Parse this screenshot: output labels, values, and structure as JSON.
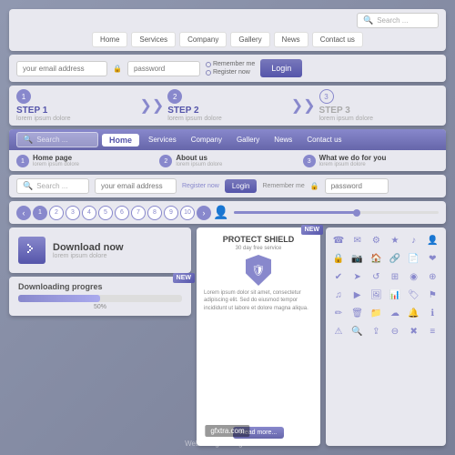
{
  "title": "Web design navigation set",
  "nav1": {
    "search_placeholder": "Search ...",
    "links": [
      "Home",
      "Services",
      "Company",
      "Gallery",
      "News",
      "Contact us"
    ]
  },
  "login1": {
    "email_placeholder": "your email address",
    "password_placeholder": "password",
    "remember_me": "Remember me",
    "register_now": "Register now",
    "login_btn": "Login"
  },
  "steps": {
    "step1_title": "STEP 1",
    "step1_sub": "lorem ipsum dolore",
    "step2_title": "STEP 2",
    "step2_sub": "lorem ipsum dolore",
    "step3_title": "STEP 3",
    "step3_sub": "lorem ipsum dolore"
  },
  "nav2": {
    "search_placeholder": "Search ...",
    "home": "Home",
    "links": [
      "Services",
      "Company",
      "Gallery",
      "News",
      "Contact us"
    ],
    "pages": [
      {
        "num": "1",
        "title": "Home page",
        "sub": "lorem ipsum dolore"
      },
      {
        "num": "2",
        "title": "About us",
        "sub": "lorem ipsum dolore"
      },
      {
        "num": "3",
        "title": "What we do for you",
        "sub": "lorem ipsum dolore"
      }
    ]
  },
  "login2": {
    "email_placeholder": "your email address",
    "register_label": "Register now",
    "login_btn": "Login",
    "remember_label": "Remember me",
    "password_placeholder": "password"
  },
  "pagination": {
    "pages": [
      "1",
      "2",
      "3",
      "4",
      "5",
      "6",
      "7",
      "8",
      "9",
      "10"
    ],
    "active": "1"
  },
  "download": {
    "title": "Download now",
    "subtitle": "lorem ipsum dolore"
  },
  "progress": {
    "title": "Downloading progres",
    "percent": "50%",
    "new_badge": "NEW"
  },
  "protect": {
    "new_badge": "NEW",
    "title": "PROTECT SHIELD",
    "subtitle": "30 day free service",
    "body": "Lorem ipsum dolor sit amet, consectetur adipiscing elit. Sed do eiusmod tempor incididunt ut labore et dolore magna aliqua.",
    "read_more": "Read more..."
  },
  "icons": [
    "☎",
    "✉",
    "🔧",
    "★",
    "♪",
    "⚙",
    "👤",
    "🔒",
    "📷",
    "🏠",
    "🔗",
    "📄",
    "❤",
    "✔",
    "➤",
    "↺",
    "⊞",
    "◉",
    "⊕",
    "✦",
    "⬟",
    "◈",
    "⊗",
    "⊘",
    "⊙",
    "⊚",
    "⊛",
    "⊜",
    "⊝",
    "⊞",
    "⊟",
    "⊠",
    "⊡",
    "⊢",
    "⊣",
    "⊤"
  ],
  "watermark": "Web design navigation set",
  "gfxtra": "gfxtra.com"
}
